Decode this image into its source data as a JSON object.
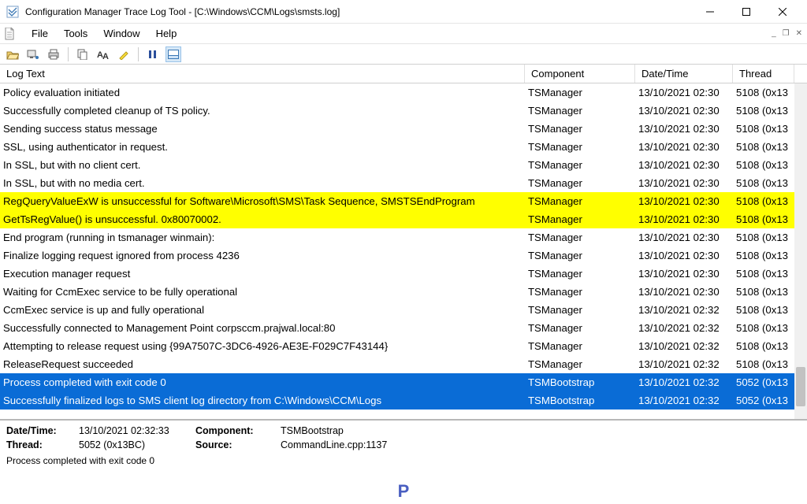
{
  "window": {
    "title": "Configuration Manager Trace Log Tool - [C:\\Windows\\CCM\\Logs\\smsts.log]"
  },
  "menu": {
    "file": "File",
    "tools": "Tools",
    "window": "Window",
    "help": "Help"
  },
  "columns": {
    "text": "Log Text",
    "component": "Component",
    "datetime": "Date/Time",
    "thread": "Thread"
  },
  "rows": [
    {
      "text": "Policy evaluation initiated",
      "component": "TSManager",
      "datetime": "13/10/2021 02:30",
      "thread": "5108 (0x13",
      "status": "info"
    },
    {
      "text": "Successfully completed cleanup of TS policy.",
      "component": "TSManager",
      "datetime": "13/10/2021 02:30",
      "thread": "5108 (0x13",
      "status": "info"
    },
    {
      "text": "Sending success status message",
      "component": "TSManager",
      "datetime": "13/10/2021 02:30",
      "thread": "5108 (0x13",
      "status": "info"
    },
    {
      "text": "SSL, using authenticator in request.",
      "component": "TSManager",
      "datetime": "13/10/2021 02:30",
      "thread": "5108 (0x13",
      "status": "info"
    },
    {
      "text": "In SSL, but with no client cert.",
      "component": "TSManager",
      "datetime": "13/10/2021 02:30",
      "thread": "5108 (0x13",
      "status": "info"
    },
    {
      "text": "In SSL, but with no media cert.",
      "component": "TSManager",
      "datetime": "13/10/2021 02:30",
      "thread": "5108 (0x13",
      "status": "info"
    },
    {
      "text": "RegQueryValueExW is unsuccessful for Software\\Microsoft\\SMS\\Task Sequence, SMSTSEndProgram",
      "component": "TSManager",
      "datetime": "13/10/2021 02:30",
      "thread": "5108 (0x13",
      "status": "warn"
    },
    {
      "text": "GetTsRegValue() is unsuccessful. 0x80070002.",
      "component": "TSManager",
      "datetime": "13/10/2021 02:30",
      "thread": "5108 (0x13",
      "status": "warn"
    },
    {
      "text": "End program (running in tsmanager winmain):",
      "component": "TSManager",
      "datetime": "13/10/2021 02:30",
      "thread": "5108 (0x13",
      "status": "info"
    },
    {
      "text": "Finalize logging request ignored from process 4236",
      "component": "TSManager",
      "datetime": "13/10/2021 02:30",
      "thread": "5108 (0x13",
      "status": "info"
    },
    {
      "text": "Execution manager request",
      "component": "TSManager",
      "datetime": "13/10/2021 02:30",
      "thread": "5108 (0x13",
      "status": "info"
    },
    {
      "text": "Waiting for CcmExec service to be fully operational",
      "component": "TSManager",
      "datetime": "13/10/2021 02:30",
      "thread": "5108 (0x13",
      "status": "info"
    },
    {
      "text": "CcmExec service is up and fully operational",
      "component": "TSManager",
      "datetime": "13/10/2021 02:32",
      "thread": "5108 (0x13",
      "status": "info"
    },
    {
      "text": "Successfully connected to Management Point corpsccm.prajwal.local:80",
      "component": "TSManager",
      "datetime": "13/10/2021 02:32",
      "thread": "5108 (0x13",
      "status": "info"
    },
    {
      "text": "Attempting to release request using {99A7507C-3DC6-4926-AE3E-F029C7F43144}",
      "component": "TSManager",
      "datetime": "13/10/2021 02:32",
      "thread": "5108 (0x13",
      "status": "info"
    },
    {
      "text": "ReleaseRequest succeeded",
      "component": "TSManager",
      "datetime": "13/10/2021 02:32",
      "thread": "5108 (0x13",
      "status": "info"
    },
    {
      "text": "Process completed with exit code 0",
      "component": "TSMBootstrap",
      "datetime": "13/10/2021 02:32",
      "thread": "5052 (0x13",
      "status": "sel"
    },
    {
      "text": "Successfully finalized logs to SMS client log directory from C:\\Windows\\CCM\\Logs",
      "component": "TSMBootstrap",
      "datetime": "13/10/2021 02:32",
      "thread": "5052 (0x13",
      "status": "sel"
    }
  ],
  "detail": {
    "labels": {
      "datetime": "Date/Time:",
      "thread": "Thread:",
      "component": "Component:",
      "source": "Source:"
    },
    "datetime": "13/10/2021 02:32:33",
    "thread": "5052 (0x13BC)",
    "component": "TSMBootstrap",
    "source": "CommandLine.cpp:1137",
    "message": "Process completed with exit code 0"
  },
  "brand_letter": "P"
}
